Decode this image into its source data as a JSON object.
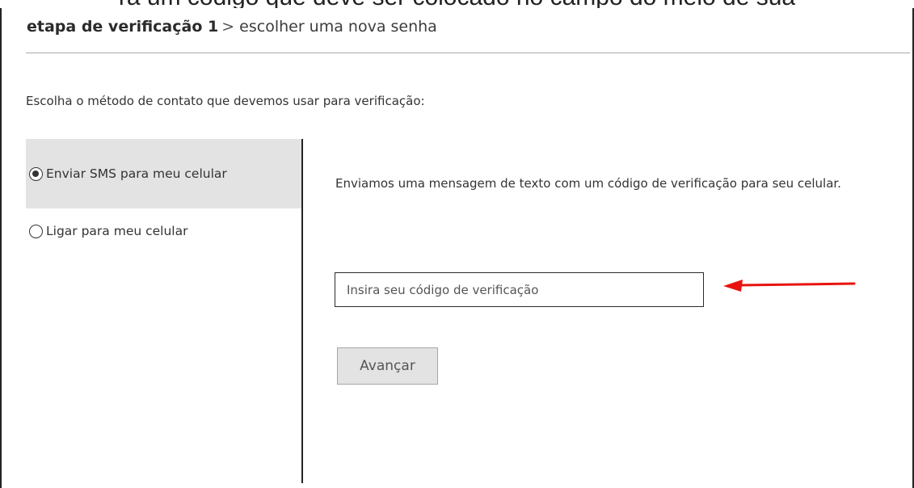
{
  "clipped_top_text": "rá um código que deve ser colocado no campo do meio de sua",
  "breadcrumb": {
    "step": "etapa de verificação 1",
    "separator": ">",
    "current": "escolher uma nova senha"
  },
  "instruction": "Escolha o método de contato que devemos usar para verificação:",
  "methods": [
    {
      "label": "Enviar SMS para meu celular",
      "selected": true
    },
    {
      "label": "Ligar para meu celular",
      "selected": false
    }
  ],
  "message": "Enviamos uma mensagem de texto com um código de verificação para seu celular.",
  "code_input": {
    "value": "",
    "placeholder": "Insira seu código de verificação"
  },
  "next_button": {
    "label": "Avançar"
  },
  "colors": {
    "arrow": "#e8130f",
    "selected_bg": "#e3e3e3",
    "button_bg": "#e3e3e3"
  },
  "icons": {
    "pointer": "red-arrow-icon",
    "radio_selected": "radio-selected-icon",
    "radio_unselected": "radio-unselected-icon"
  }
}
